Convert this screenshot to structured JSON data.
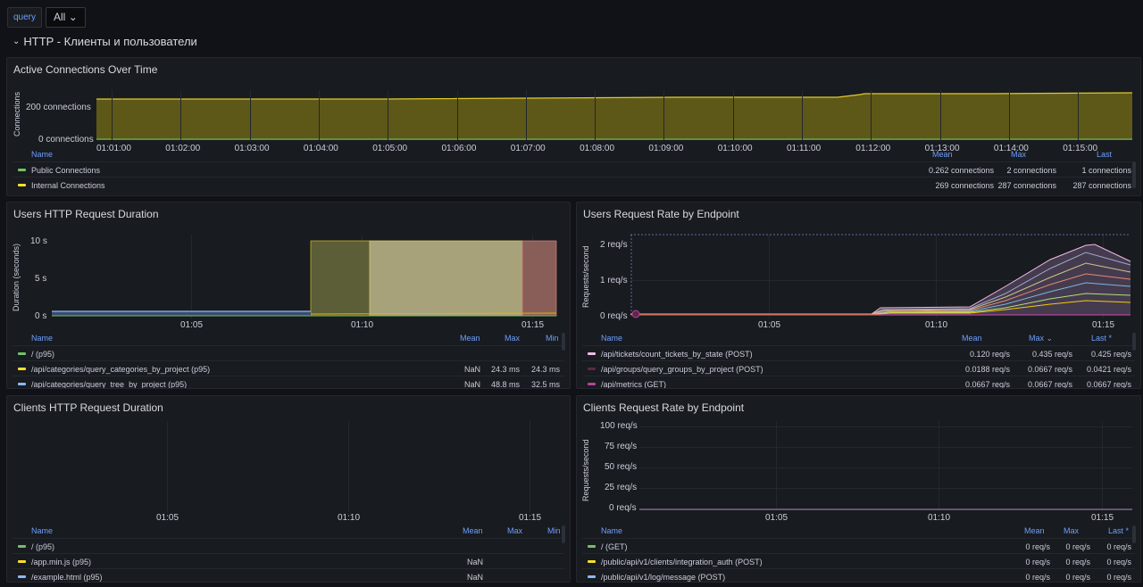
{
  "toolbar": {
    "var_label": "query",
    "var_value": "All"
  },
  "row": {
    "title": "HTTP - Клиенты и пользователи"
  },
  "panels": {
    "active": {
      "title": "Active Connections Over Time",
      "ylabel": "Connections",
      "yticks": [
        "200 connections",
        "0 connections"
      ],
      "xticks": [
        "01:01:00",
        "01:02:00",
        "01:03:00",
        "01:04:00",
        "01:05:00",
        "01:06:00",
        "01:07:00",
        "01:08:00",
        "01:09:00",
        "01:10:00",
        "01:11:00",
        "01:12:00",
        "01:13:00",
        "01:14:00",
        "01:15:00"
      ],
      "legend_cols": [
        "Name",
        "Mean",
        "Max",
        "Last"
      ],
      "legend": [
        {
          "name": "Public Connections",
          "color": "#73bf69",
          "mean": "0.262 connections",
          "max": "2 connections",
          "last": "1 connections"
        },
        {
          "name": "Internal Connections",
          "color": "#fade2a",
          "mean": "269 connections",
          "max": "287 connections",
          "last": "287 connections"
        }
      ]
    },
    "users_dur": {
      "title": "Users HTTP Request Duration",
      "ylabel": "Duration (seconds)",
      "yticks": [
        "10 s",
        "5 s",
        "0 s"
      ],
      "xticks": [
        "01:05",
        "01:10",
        "01:15"
      ],
      "legend_cols": [
        "Name",
        "Mean",
        "Max",
        "Min"
      ],
      "legend": [
        {
          "name": "/ (p95)",
          "color": "#73bf69",
          "mean": "",
          "max": "",
          "min": ""
        },
        {
          "name": "/api/categories/query_categories_by_project (p95)",
          "color": "#fade2a",
          "mean": "NaN",
          "max": "24.3 ms",
          "min": "24.3 ms"
        },
        {
          "name": "/api/categories/query_tree_by_project (p95)",
          "color": "#8ab8ff",
          "mean": "NaN",
          "max": "48.8 ms",
          "min": "32.5 ms"
        }
      ]
    },
    "users_rate": {
      "title": "Users Request Rate by Endpoint",
      "ylabel": "Requests/second",
      "yticks": [
        "2 req/s",
        "1 req/s",
        "0 req/s"
      ],
      "xticks": [
        "01:05",
        "01:10",
        "01:15"
      ],
      "legend_cols": [
        "Name",
        "Mean",
        "Max",
        "Last *"
      ],
      "legend": [
        {
          "name": "/api/tickets/count_tickets_by_state (POST)",
          "color": "#f5b8e6",
          "mean": "0.120 req/s",
          "max": "0.435 req/s",
          "last": "0.425 req/s"
        },
        {
          "name": "/api/groups/query_groups_by_project (POST)",
          "color": "#5a2a45",
          "mean": "0.0188 req/s",
          "max": "0.0667 req/s",
          "last": "0.0421 req/s"
        },
        {
          "name": "/api/metrics (GET)",
          "color": "#b8429a",
          "mean": "0.0667 req/s",
          "max": "0.0667 req/s",
          "last": "0.0667 req/s"
        }
      ]
    },
    "clients_dur": {
      "title": "Clients HTTP Request Duration",
      "xticks": [
        "01:05",
        "01:10",
        "01:15"
      ],
      "legend_cols": [
        "Name",
        "Mean",
        "Max",
        "Min"
      ],
      "legend": [
        {
          "name": "/ (p95)",
          "color": "#73bf69",
          "mean": "",
          "max": "",
          "min": ""
        },
        {
          "name": "/app.min.js (p95)",
          "color": "#fade2a",
          "mean": "NaN",
          "max": "",
          "min": ""
        },
        {
          "name": "/example.html (p95)",
          "color": "#8ab8ff",
          "mean": "NaN",
          "max": "",
          "min": ""
        }
      ]
    },
    "clients_rate": {
      "title": "Clients Request Rate by Endpoint",
      "ylabel": "Requests/second",
      "yticks": [
        "100 req/s",
        "75 req/s",
        "50 req/s",
        "25 req/s",
        "0 req/s"
      ],
      "xticks": [
        "01:05",
        "01:10",
        "01:15"
      ],
      "legend_cols": [
        "Name",
        "Mean",
        "Max",
        "Last *"
      ],
      "legend": [
        {
          "name": "/ (GET)",
          "color": "#73bf69",
          "mean": "0 req/s",
          "max": "0 req/s",
          "last": "0 req/s"
        },
        {
          "name": "/public/api/v1/clients/integration_auth (POST)",
          "color": "#fade2a",
          "mean": "0 req/s",
          "max": "0 req/s",
          "last": "0 req/s"
        },
        {
          "name": "/public/api/v1/log/message (POST)",
          "color": "#8ab8ff",
          "mean": "0 req/s",
          "max": "0 req/s",
          "last": "0 req/s"
        }
      ]
    }
  }
}
